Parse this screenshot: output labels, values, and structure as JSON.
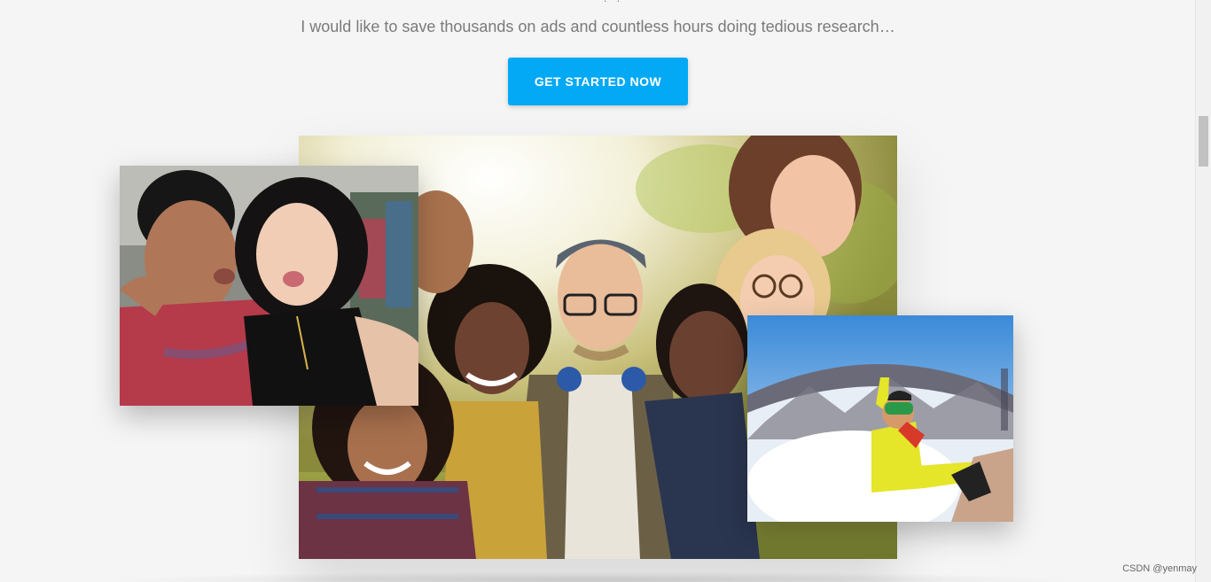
{
  "hero": {
    "subtitle": "I would like to save thousands on ads and countless hours doing tedious research…",
    "cta_label": "GET STARTED NOW"
  },
  "photos": {
    "main": "group-selfie-photo",
    "left": "couple-selfie-photo",
    "right": "skier-selfie-photo"
  },
  "colors": {
    "cta": "#03a9f4",
    "background": "#f5f5f5"
  },
  "watermark": "CSDN @yenmay"
}
